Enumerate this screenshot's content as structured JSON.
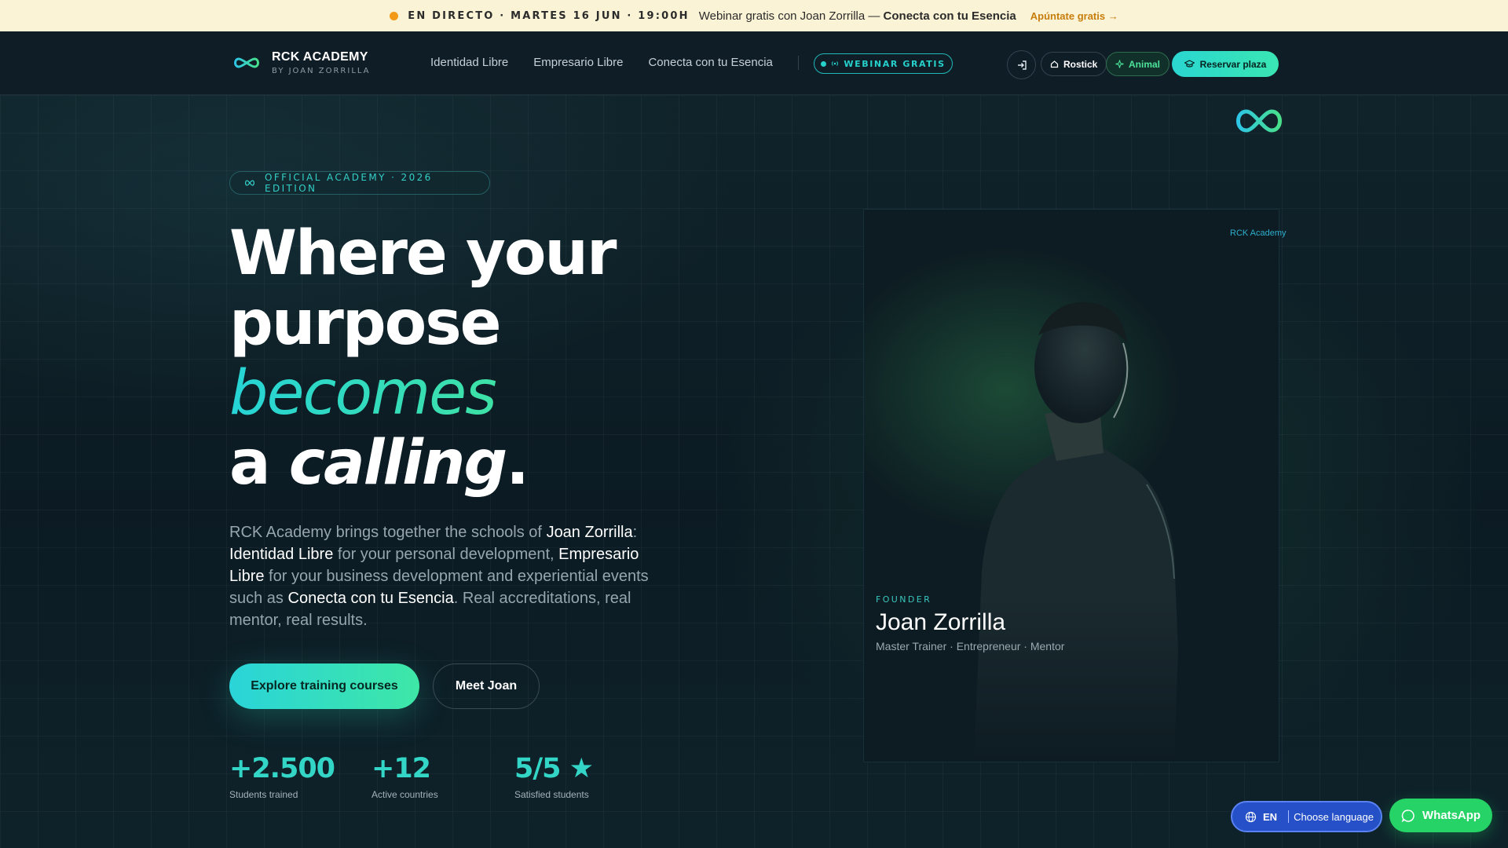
{
  "announcement": {
    "live_label": "EN DIRECTO · MARTES 16 JUN · 19:00H",
    "message_prefix": "Webinar gratis con Joan Zorrilla —",
    "message_bold": "Conecta con tu Esencia",
    "cta": "Apúntate gratis →",
    "accent_color": "#f29a17"
  },
  "header": {
    "brand_title": "RCK ACADEMY",
    "brand_subtitle": "BY JOAN ZORRILLA",
    "nav": [
      "Identidad Libre",
      "Empresario Libre",
      "Conecta con tu Esencia"
    ],
    "webinar_pill": "WEBINAR GRATIS",
    "login_icon": "login-icon",
    "chip_rostick": "Rostick",
    "chip_animal": "Animal",
    "reserve_button": "Reservar plaza"
  },
  "hero": {
    "badge": "OFFICIAL ACADEMY · 2026 EDITION",
    "headline": {
      "line1": "Where your",
      "line2": "purpose",
      "line3": "becomes",
      "line4_a": "a",
      "line4_b": "calling",
      "line4_c": "."
    },
    "lead": {
      "p1": "RCK Academy brings together the schools of",
      "n1": "Joan Zorrilla",
      "p2": ":",
      "n2": "Identidad Libre",
      "p3": "for your personal development,",
      "n3": "Empresario Libre",
      "p4": "for your business development and experiential events such as",
      "n4": "Conecta con tu Esencia",
      "p5": ". Real accreditations, real mentor, real results."
    },
    "primary_button": "Explore training courses",
    "secondary_button": "Meet Joan",
    "stats": [
      {
        "value": "+2.500",
        "label": "Students trained"
      },
      {
        "value": "+12",
        "label": "Active countries"
      },
      {
        "value": "5/5 ★",
        "label": "Satisfied students"
      }
    ],
    "gradient_colors": [
      "#26d4d6",
      "#3ee2a6"
    ]
  },
  "founder_card": {
    "label": "FOUNDER",
    "name": "Joan Zorrilla",
    "role": "Master Trainer · Entrepreneur · Mentor",
    "logo_text": "RCK Academy"
  },
  "floating": {
    "lang_code": "EN",
    "lang_label": "Choose language",
    "whatsapp": "WhatsApp",
    "whatsapp_color": "#25d366",
    "lang_color": "#2550c7"
  }
}
